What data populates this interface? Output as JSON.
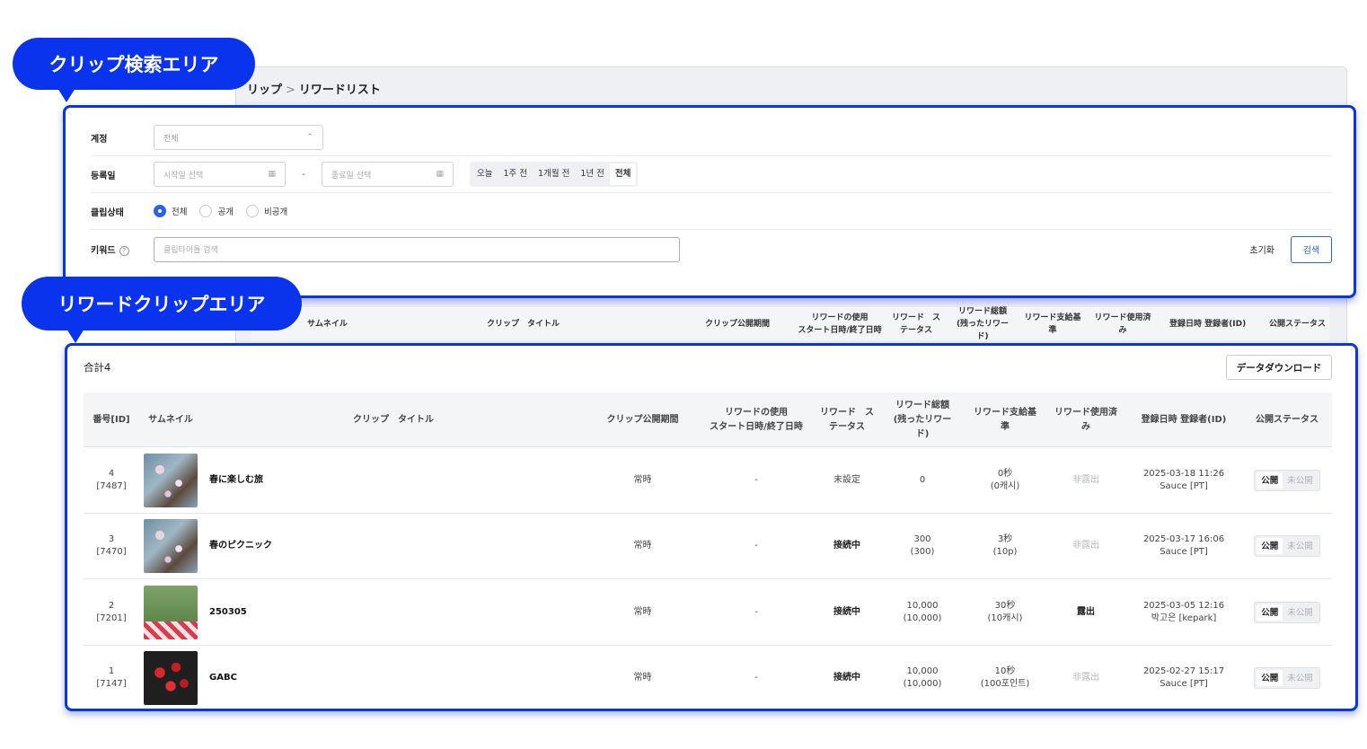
{
  "callouts": {
    "search_area": "クリップ検索エリア",
    "reward_area": "リワードクリップエリア"
  },
  "breadcrumb": {
    "parent": "リップ",
    "separator": ">",
    "current": "リワードリスト"
  },
  "search": {
    "account": {
      "label": "계정",
      "value": "전체"
    },
    "registered_date": {
      "label": "등록일",
      "start_placeholder": "시작일 선택",
      "end_placeholder": "종료일 선택",
      "dash": "-",
      "ranges": [
        "오늘",
        "1주 전",
        "1개월 전",
        "1년 전",
        "전체"
      ],
      "active_range": "전체"
    },
    "clip_status": {
      "label": "클립상태",
      "options": [
        "전체",
        "공개",
        "비공개"
      ],
      "selected": "전체"
    },
    "keyword": {
      "label": "키워드",
      "help": "?",
      "placeholder": "클립타이틀 검색"
    },
    "reset_label": "초기화",
    "search_label": "검색"
  },
  "ghost_header": [
    "サムネイル",
    "クリップ　タイトル",
    "クリップ公開期間",
    "リワードの使用\nスタート日時/終了日時",
    "リワード　ス\nテータス",
    "リワード総額\n(残ったリワー\nド)",
    "リワード支給基\n準",
    "リワード使用済\nみ",
    "登録日時 登録者(ID)",
    "公開ステータス"
  ],
  "reward": {
    "total_label": "合計4",
    "download_label": "データダウンロード",
    "columns": [
      "番号[ID]",
      "サムネイル",
      "クリップ　タイトル",
      "クリップ公開期間",
      "リワードの使用\nスタート日時/終了日時",
      "リワード　ス\nテータス",
      "リワード総額\n(残ったリワー\nド)",
      "リワード支給基\n準",
      "リワード使用済\nみ",
      "登録日時 登録者(ID)",
      "公開ステータス"
    ],
    "rows": [
      {
        "no": "4",
        "id": "[7487]",
        "thumb": "flower",
        "title": "春に楽しむ旅",
        "period": "常時",
        "reward_period": "-",
        "status": "未設定",
        "status_bold": false,
        "total": "0",
        "remaining": "",
        "basis": "0秒",
        "basis_sub": "(0캐시)",
        "used": "非露出",
        "used_muted": true,
        "date": "2025-03-18 11:26",
        "user": "Sauce [PT]",
        "toggle_on": "公開",
        "toggle_off": "未公開"
      },
      {
        "no": "3",
        "id": "[7470]",
        "thumb": "flower",
        "title": "春のピクニック",
        "period": "常時",
        "reward_period": "-",
        "status": "接続中",
        "status_bold": true,
        "total": "300",
        "remaining": "(300)",
        "basis": "3秒",
        "basis_sub": "(10p)",
        "used": "非露出",
        "used_muted": true,
        "date": "2025-03-17 16:06",
        "user": "Sauce [PT]",
        "toggle_on": "公開",
        "toggle_off": "未公開"
      },
      {
        "no": "2",
        "id": "[7201]",
        "thumb": "picnic",
        "title": "250305",
        "period": "常時",
        "reward_period": "-",
        "status": "接続中",
        "status_bold": true,
        "total": "10,000",
        "remaining": "(10,000)",
        "basis": "30秒",
        "basis_sub": "(10캐시)",
        "used": "露出",
        "used_muted": false,
        "date": "2025-03-05 12:16",
        "user": "박고은 [kepark]",
        "toggle_on": "公開",
        "toggle_off": "未公開"
      },
      {
        "no": "1",
        "id": "[7147]",
        "thumb": "berry",
        "title": "GABC",
        "period": "常時",
        "reward_period": "-",
        "status": "接続中",
        "status_bold": true,
        "total": "10,000",
        "remaining": "(10,000)",
        "basis": "10秒",
        "basis_sub": "(100포인트)",
        "used": "非露出",
        "used_muted": true,
        "date": "2025-02-27 15:17",
        "user": "Sauce [PT]",
        "toggle_on": "公開",
        "toggle_off": "未公開"
      }
    ]
  },
  "colors": {
    "accent": "#0a33ee",
    "primary_button": "#2a62e8"
  }
}
